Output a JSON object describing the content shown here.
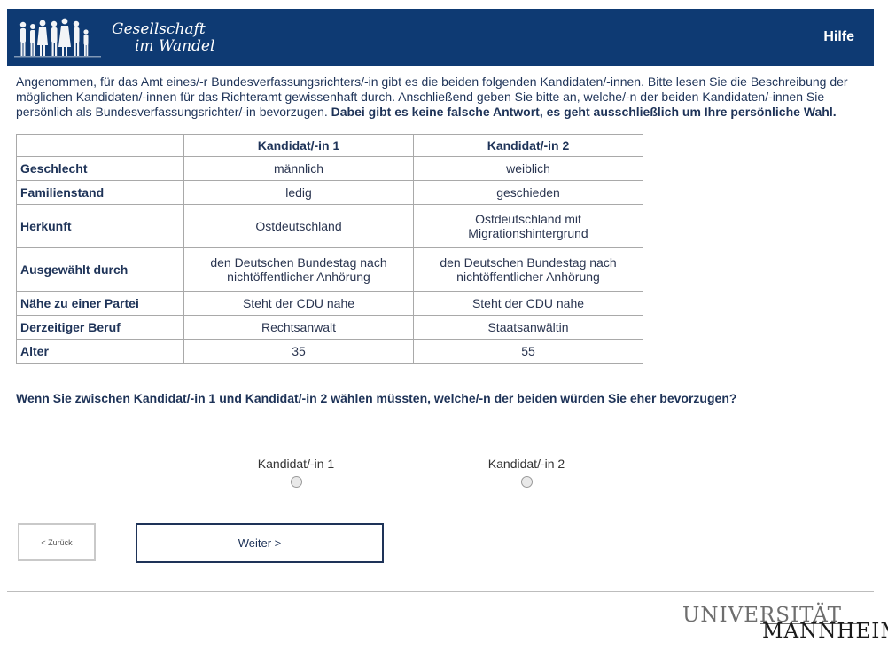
{
  "header": {
    "logo_line1": "Gesellschaft",
    "logo_line2": "im Wandel",
    "help_label": "Hilfe"
  },
  "intro": {
    "text": "Angenommen, für das Amt eines/-r Bundesverfassungsrichters/-in gibt es die beiden folgenden Kandidaten/-innen. Bitte lesen Sie die Beschreibung der möglichen Kandidaten/-innen für das Richteramt gewissenhaft durch. Anschließend geben Sie bitte an, welche/-n der beiden Kandidaten/-innen Sie persönlich als Bundesverfassungsrichter/-in bevorzugen. ",
    "bold": "Dabei gibt es keine falsche Antwort, es geht ausschließlich um Ihre persönliche Wahl."
  },
  "table": {
    "headers": [
      "",
      "Kandidat/-in 1",
      "Kandidat/-in 2"
    ],
    "rows": [
      {
        "attr": "Geschlecht",
        "c1": "männlich",
        "c2": "weiblich"
      },
      {
        "attr": "Familienstand",
        "c1": "ledig",
        "c2": "geschieden"
      },
      {
        "attr": "Herkunft",
        "c1": "Ostdeutschland",
        "c2": "Ostdeutschland mit Migrationshintergrund"
      },
      {
        "attr": "Ausgewählt durch",
        "c1": "den Deutschen Bundestag nach nichtöffentlicher Anhörung",
        "c2": "den Deutschen Bundestag nach nichtöffentlicher Anhörung"
      },
      {
        "attr": "Nähe zu einer Partei",
        "c1": "Steht der CDU nahe",
        "c2": "Steht der CDU nahe"
      },
      {
        "attr": "Derzeitiger Beruf",
        "c1": "Rechtsanwalt",
        "c2": "Staatsanwältin"
      },
      {
        "attr": "Alter",
        "c1": "35",
        "c2": "55"
      }
    ]
  },
  "question": {
    "text": "Wenn Sie zwischen Kandidat/-in 1 und Kandidat/-in 2 wählen müssten, welche/-n der beiden würden Sie eher bevorzugen?",
    "options": [
      "Kandidat/-in 1",
      "Kandidat/-in 2"
    ],
    "selected": ""
  },
  "nav": {
    "back_label": "< Zurück",
    "next_label": "Weiter >"
  },
  "footer": {
    "uni_line1": "UNIVERSITÄT",
    "uni_line2": "MANNHEIM"
  },
  "colors": {
    "header_bg": "#0e3a73",
    "text": "#1e3358"
  }
}
